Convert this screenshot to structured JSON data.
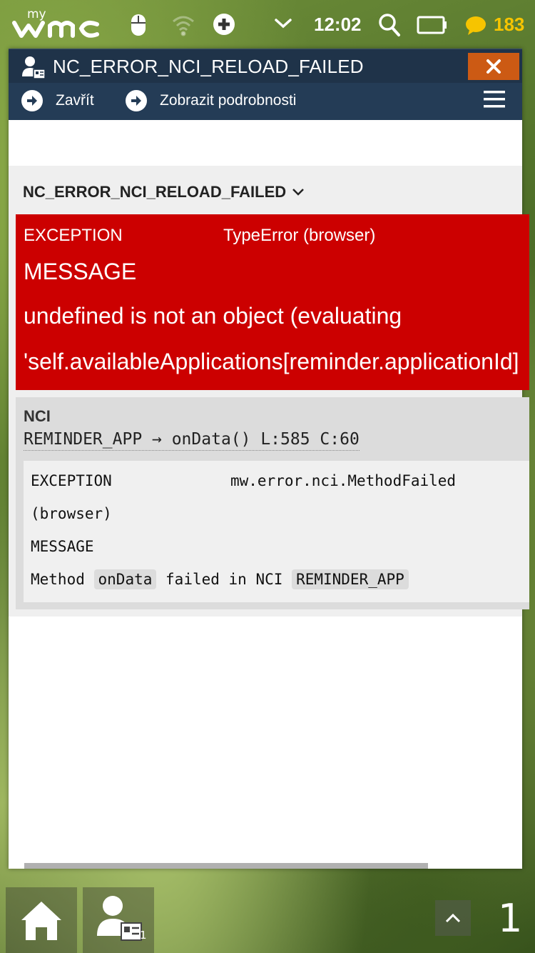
{
  "statusbar": {
    "logo_my": "my",
    "logo_text": "WMC",
    "clock": "12:02",
    "notification_count": "183",
    "colors": {
      "notification": "#f6c400"
    }
  },
  "window": {
    "title": "NC_ERROR_NCI_RELOAD_FAILED",
    "close_label": "✕",
    "toolbar": {
      "close_label": "Zavřít",
      "details_label": "Zobrazit podrobnosti"
    },
    "colors": {
      "titlebar": "#1f3349",
      "close": "#cc5a14",
      "error": "#cc0000"
    }
  },
  "error": {
    "heading": "NC_ERROR_NCI_RELOAD_FAILED",
    "exception_key": "EXCEPTION",
    "exception_value": "TypeError (browser)",
    "message_key": "MESSAGE",
    "message_line1": "undefined is not an object (evaluating",
    "message_line2": "'self.availableApplications[reminder.applicationId]"
  },
  "nci": {
    "label": "NCI",
    "trace": "REMINDER_APP → onData() L:585 C:60",
    "exception_key": "EXCEPTION",
    "exception_value": "mw.error.nci.MethodFailed",
    "exception_suffix": "(browser)",
    "message_key": "MESSAGE",
    "message_prefix": "Method",
    "message_method": "onData",
    "message_middle": "failed in NCI",
    "message_app": "REMINDER_APP"
  },
  "dock": {
    "app_badge": "1",
    "desktop_number": "1"
  }
}
